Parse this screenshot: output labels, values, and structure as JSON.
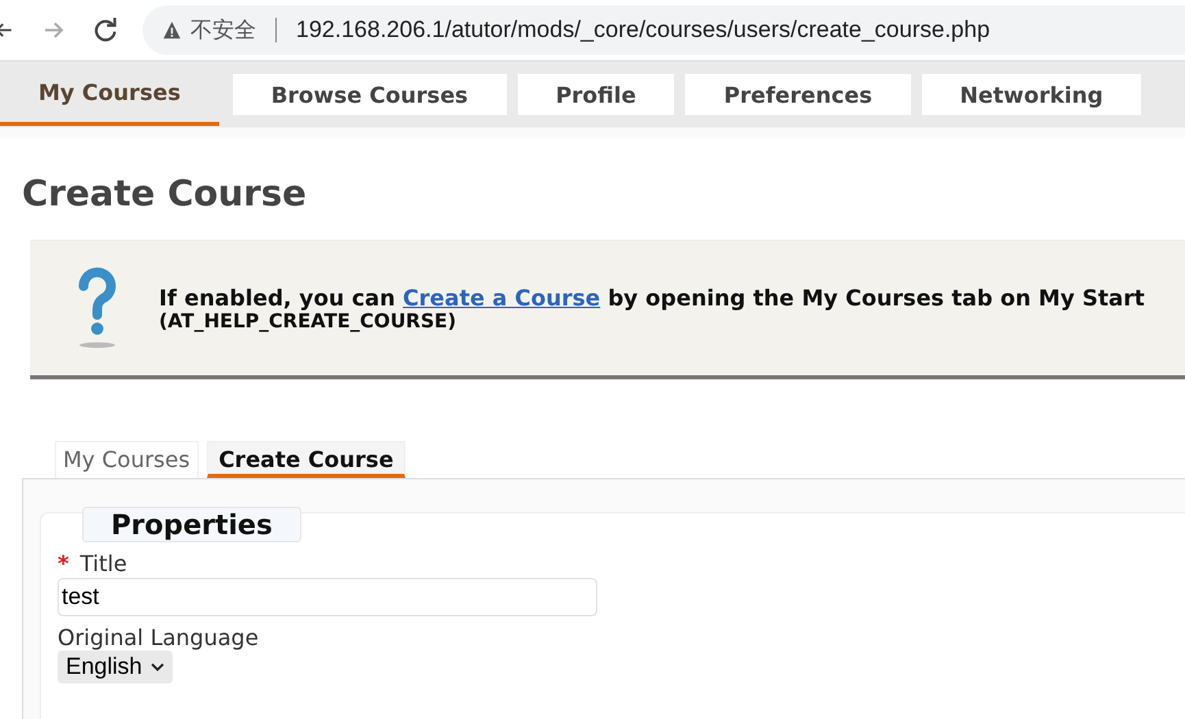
{
  "browser": {
    "security_label": "不安全",
    "url": "192.168.206.1/atutor/mods/_core/courses/users/create_course.php"
  },
  "nav_tabs": [
    {
      "label": "My Courses",
      "selected": true
    },
    {
      "label": "Browse Courses",
      "selected": false
    },
    {
      "label": "Profile",
      "selected": false
    },
    {
      "label": "Preferences",
      "selected": false
    },
    {
      "label": "Networking",
      "selected": false
    }
  ],
  "page_title": "Create Course",
  "help": {
    "before": "If enabled, you can ",
    "link": "Create a Course",
    "after": " by opening the My Courses tab on My Start",
    "code": "(AT_HELP_CREATE_COURSE)"
  },
  "sub_tabs": [
    {
      "label": "My Courses",
      "selected": false
    },
    {
      "label": "Create Course",
      "selected": true
    }
  ],
  "form": {
    "legend": "Properties",
    "fields": [
      {
        "kind": "text",
        "label": "Title",
        "required_mark": "*",
        "value": "test"
      },
      {
        "kind": "select",
        "label": "Original Language",
        "value": "English"
      }
    ]
  }
}
